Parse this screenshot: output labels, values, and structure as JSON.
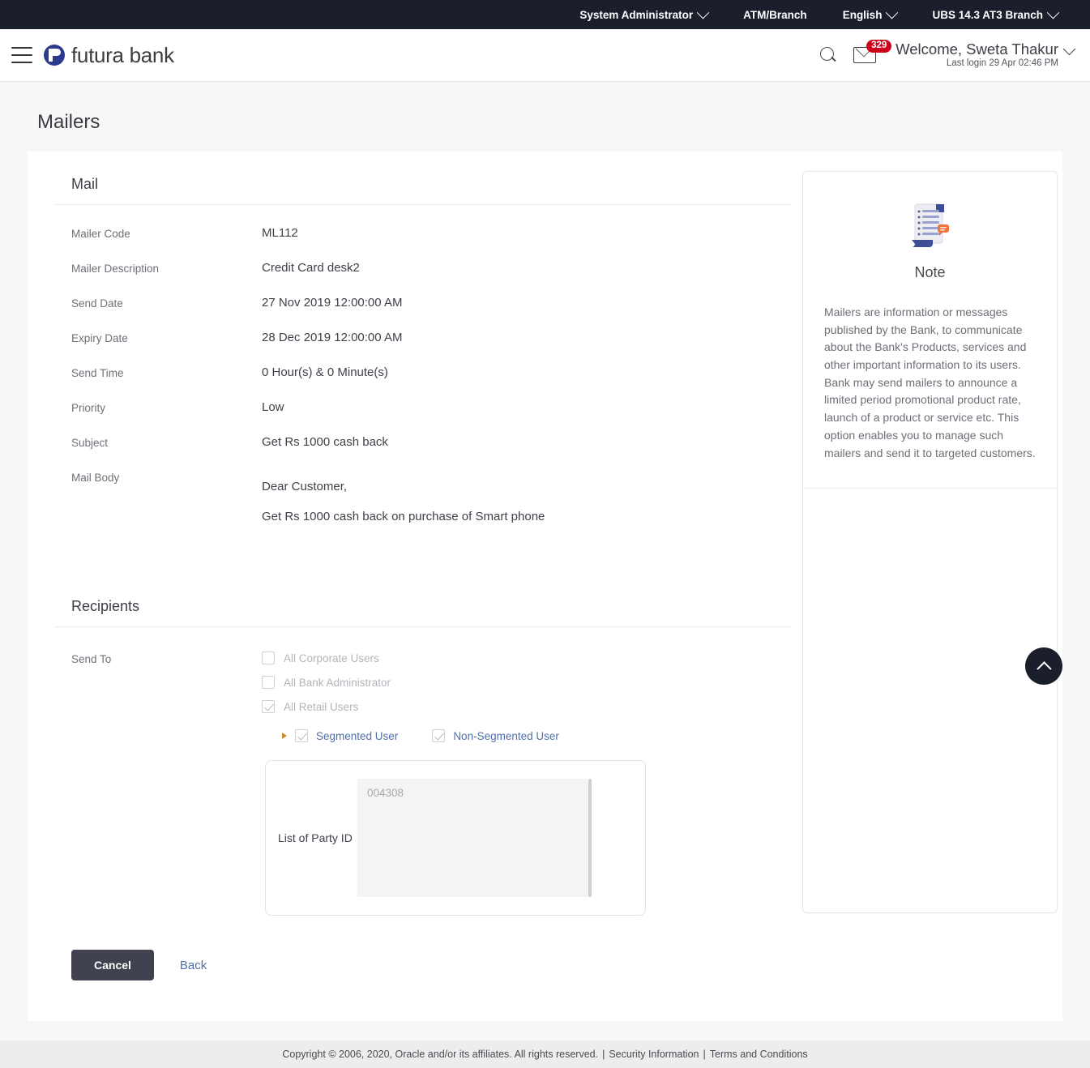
{
  "topbar": {
    "items": [
      {
        "label": "System Administrator",
        "caret": true,
        "icon": "chevron-down-icon"
      },
      {
        "label": "ATM/Branch",
        "caret": false,
        "icon": ""
      },
      {
        "label": "English",
        "caret": true,
        "icon": "chevron-down-icon"
      },
      {
        "label": "UBS 14.3 AT3 Branch",
        "caret": true,
        "icon": "chevron-down-icon"
      }
    ]
  },
  "header": {
    "menu_icon": "hamburger-icon",
    "brand": "futura bank",
    "search_icon": "search-icon",
    "mail_icon": "envelope-icon",
    "mail_badge": "329",
    "welcome": "Welcome, Sweta Thakur",
    "last_login": "Last login 29 Apr 02:46 PM",
    "profile_caret": "chevron-down-icon"
  },
  "page": {
    "title": "Mailers"
  },
  "mail_section": {
    "heading": "Mail",
    "fields": [
      {
        "label": "Mailer Code",
        "value": "ML112"
      },
      {
        "label": "Mailer Description",
        "value": "Credit Card desk2"
      },
      {
        "label": "Send Date",
        "value": "27 Nov 2019 12:00:00 AM"
      },
      {
        "label": "Expiry Date",
        "value": "28 Dec 2019 12:00:00 AM"
      },
      {
        "label": "Send Time",
        "value": "0 Hour(s) & 0 Minute(s)"
      },
      {
        "label": "Priority",
        "value": "Low"
      },
      {
        "label": "Subject",
        "value": "Get Rs 1000 cash back"
      }
    ],
    "mail_body_label": "Mail Body",
    "mail_body_lines": [
      "Dear Customer,",
      "Get Rs 1000 cash back on purchase of Smart phone"
    ]
  },
  "recipients_section": {
    "heading": "Recipients",
    "send_to_label": "Send To",
    "checkboxes": [
      {
        "label": "All Corporate Users",
        "checked": false
      },
      {
        "label": "All Bank Administrator",
        "checked": false
      },
      {
        "label": "All Retail Users",
        "checked": true
      }
    ],
    "sub_options": [
      {
        "label": "Segmented User",
        "checked": true
      },
      {
        "label": "Non-Segmented User",
        "checked": true
      }
    ],
    "expand_icon": "triangle-right-icon",
    "party": {
      "label": "List of Party ID",
      "value": "004308"
    }
  },
  "actions": {
    "cancel": "Cancel",
    "back": "Back"
  },
  "note": {
    "icon": "document-note-icon",
    "title": "Note",
    "text": "Mailers are information or messages published by the Bank, to communicate about the Bank's Products, services and other important information to its users. Bank may send mailers to announce a limited period promotional product rate, launch of a product or service etc. This option enables you to manage such mailers and send it to targeted customers."
  },
  "scroll_top": {
    "icon": "chevron-up-icon"
  },
  "footer": {
    "copyright": "Copyright © 2006, 2020, Oracle and/or its affiliates. All rights reserved.",
    "security": "Security Information",
    "terms": "Terms and Conditions",
    "separator": "|"
  },
  "colors": {
    "topbar_bg": "#1b1e2b",
    "brand_blue": "#2b3a8f",
    "badge_red": "#d0021b",
    "link_blue": "#4f6fa8",
    "button_dark": "#40434f",
    "page_bg": "#f7f7f7"
  }
}
